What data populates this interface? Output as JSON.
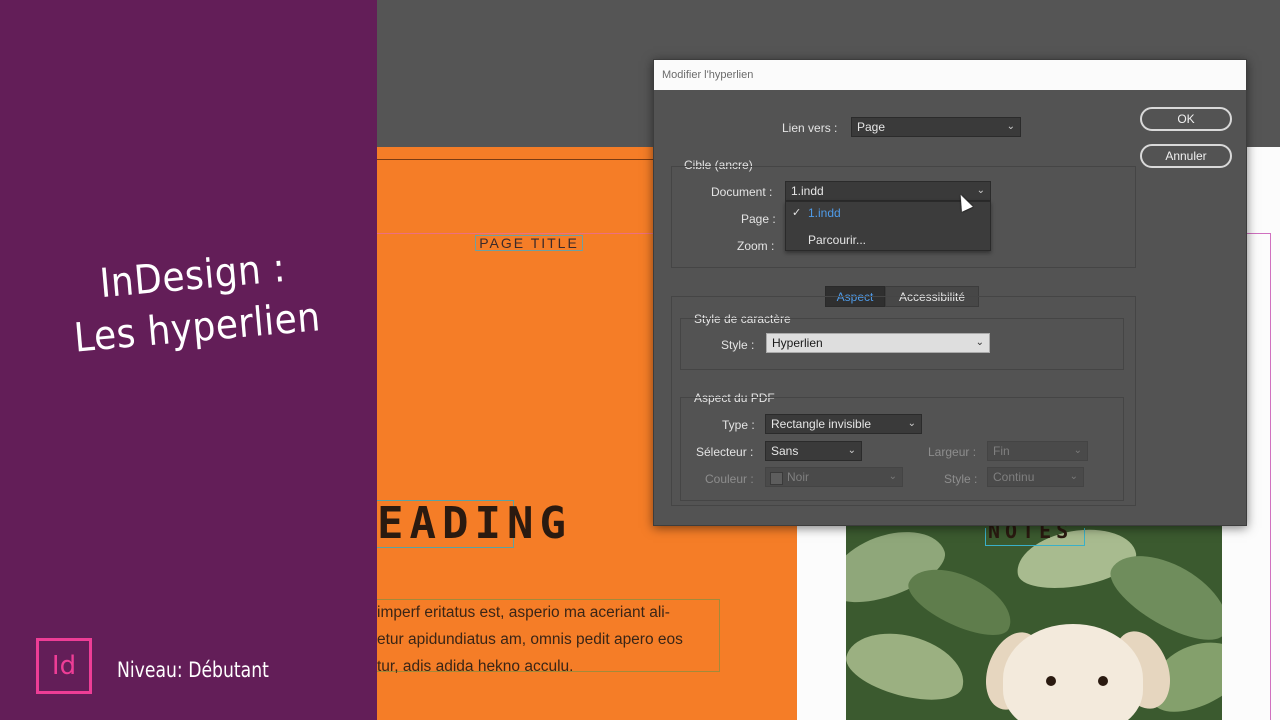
{
  "promo": {
    "title_line1": "InDesign :",
    "title_line2": "Les hyperlien",
    "logo_text": "Id",
    "level": "Niveau: Débutant"
  },
  "document": {
    "page_title": "PAGE TITLE",
    "heading": "EADING",
    "body_lines": [
      "imperf eritatus est, asperio ma aceriant ali-",
      "etur apidundiatus am, omnis pedit apero eos",
      "tur, adis adida hekno acculu."
    ],
    "notes_heading": "NOTES"
  },
  "dialog": {
    "title": "Modifier l'hyperlien",
    "link_to_label": "Lien vers :",
    "link_to_value": "Page",
    "target_group": "Cible (ancre)",
    "document_label": "Document :",
    "document_value": "1.indd",
    "page_label": "Page :",
    "zoom_label": "Zoom :",
    "document_menu": {
      "items": [
        "1.indd",
        "Parcourir..."
      ],
      "selected": "1.indd",
      "check": "✓"
    },
    "ok_label": "OK",
    "cancel_label": "Annuler",
    "tabs": [
      "Aspect",
      "Accessibilité"
    ],
    "active_tab": "Aspect",
    "char_style_group": "Style de caractère",
    "style_label": "Style :",
    "style_value": "Hyperlien",
    "pdf_group": "Aspect du PDF",
    "type_label": "Type :",
    "type_value": "Rectangle invisible",
    "selector_label": "Sélecteur :",
    "selector_value": "Sans",
    "width_label": "Largeur :",
    "width_value": "Fin",
    "color_label": "Couleur :",
    "color_value": "Noir",
    "stroke_style_label": "Style :",
    "stroke_style_value": "Continu",
    "chevron": "⌄"
  },
  "colors": {
    "promo_panel": "#631e58",
    "indesign_logo": "#ee3d96",
    "orange_page": "#f57d27",
    "accent_tab": "#4f9be8"
  }
}
